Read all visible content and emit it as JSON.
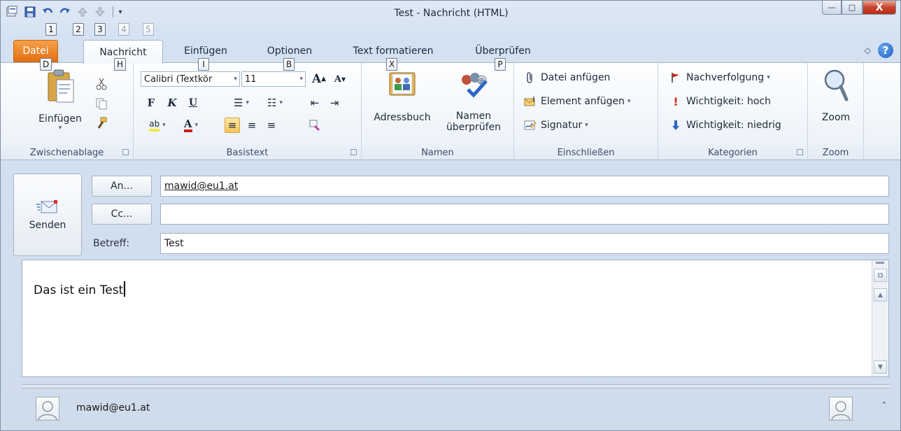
{
  "window": {
    "title": "Test - Nachricht (HTML)",
    "controls": {
      "minimize": "—",
      "maximize": "□",
      "close": "X"
    }
  },
  "quick_access": {
    "keytips": [
      "1",
      "2",
      "3",
      "4",
      "5"
    ],
    "icons": [
      "outlook-icon",
      "save-icon",
      "undo-icon",
      "redo-icon",
      "up-arrow-icon",
      "down-arrow-icon"
    ]
  },
  "tabs": {
    "file": "Datei",
    "items": [
      "Nachricht",
      "Einfügen",
      "Optionen",
      "Text formatieren",
      "Überprüfen"
    ],
    "active": "Nachricht",
    "keytips": {
      "file": "D",
      "message": "H",
      "insert": "I",
      "options": "B",
      "format": "X",
      "review": "P"
    }
  },
  "ribbon": {
    "clipboard": {
      "label": "Zwischenablage",
      "paste": "Einfügen"
    },
    "basic_text": {
      "label": "Basistext",
      "font_name": "Calibri (Textkör",
      "font_size": "11",
      "bold": "F",
      "italic": "K",
      "underline": "U",
      "grow": "A",
      "shrink": "A"
    },
    "names": {
      "label": "Namen",
      "address_book": "Adressbuch",
      "check_names_1": "Namen",
      "check_names_2": "überprüfen"
    },
    "include": {
      "label": "Einschließen",
      "attach_file": "Datei anfügen",
      "attach_item": "Element anfügen",
      "signature": "Signatur"
    },
    "tags": {
      "label": "Kategorien",
      "followup": "Nachverfolgung",
      "high": "Wichtigkeit: hoch",
      "low": "Wichtigkeit: niedrig"
    },
    "zoom": {
      "label": "Zoom",
      "button": "Zoom"
    }
  },
  "compose": {
    "send": "Senden",
    "to_button": "An...",
    "cc_button": "Cc...",
    "subject_label": "Betreff:",
    "to_value": "mawid@eu1.at",
    "cc_value": "",
    "subject_value": "Test",
    "body": "Das ist ein Test"
  },
  "people_pane": {
    "name": "mawid@eu1.at",
    "caret": "˄"
  },
  "colors": {
    "file_tab": "#e36f12",
    "close_button": "#c9432c",
    "accent": "#1d5fbf"
  }
}
